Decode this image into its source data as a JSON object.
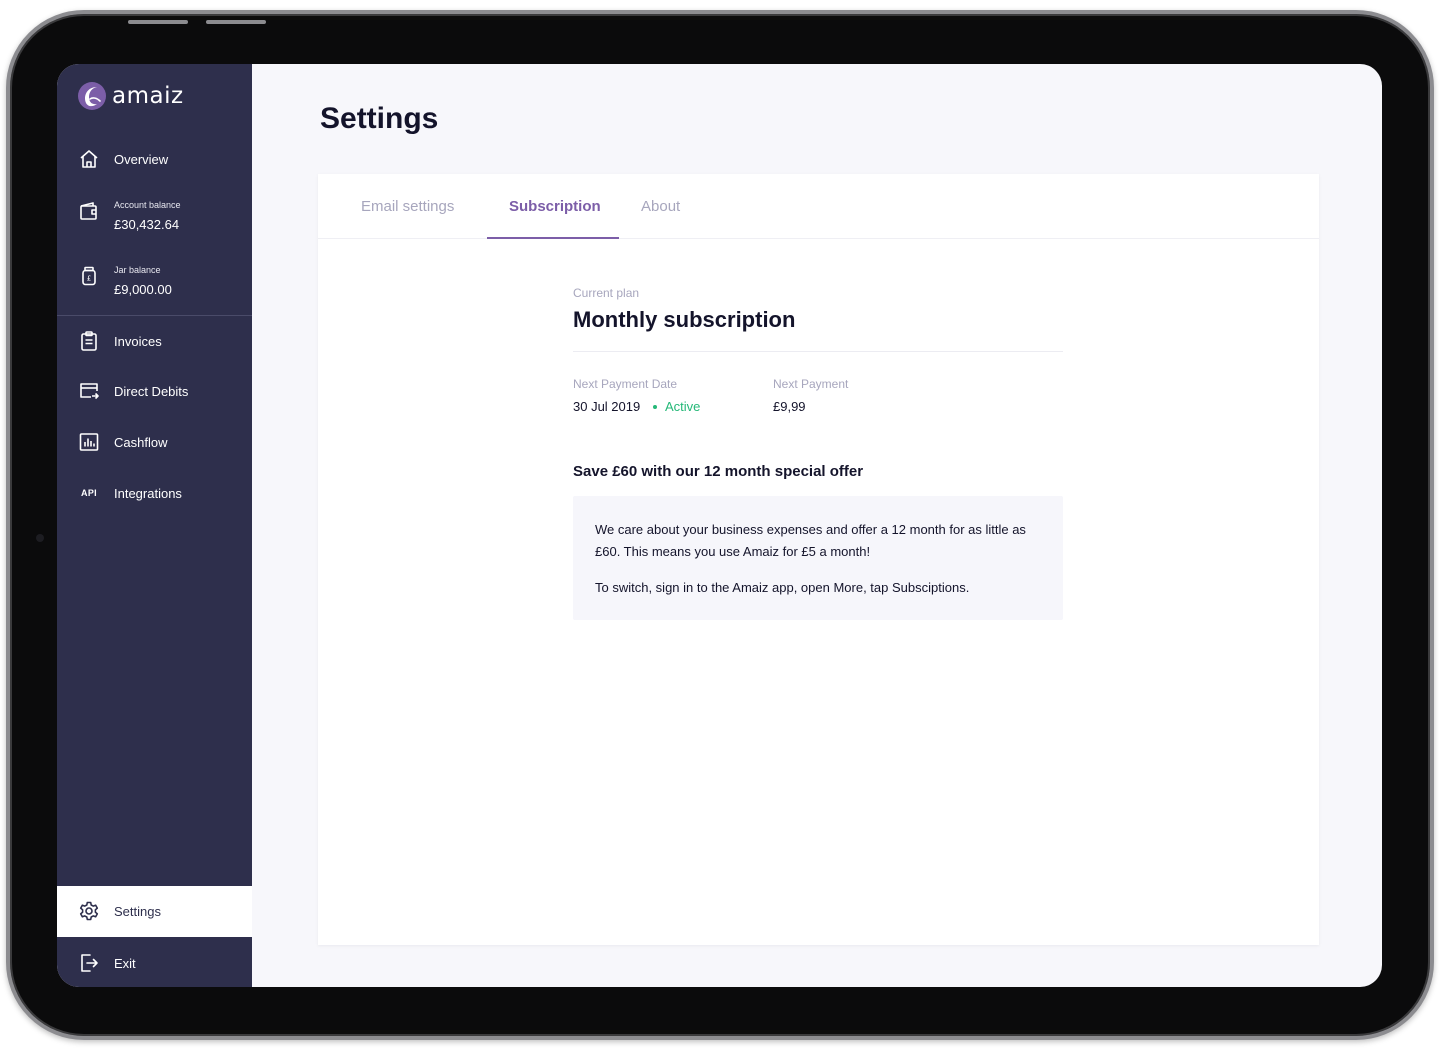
{
  "brand": {
    "name": "amaiz",
    "accent": "#7c5ea8",
    "sidebar_bg": "#2e2f4c",
    "active_green": "#25b878"
  },
  "sidebar": {
    "items": [
      {
        "id": "overview",
        "label": "Overview",
        "icon": "home-icon"
      },
      {
        "id": "account-balance",
        "label": "Account balance",
        "value": "£30,432.64",
        "icon": "wallet-icon"
      },
      {
        "id": "jar-balance",
        "label": "Jar balance",
        "value": "£9,000.00",
        "icon": "jar-icon"
      },
      {
        "id": "invoices",
        "label": "Invoices",
        "icon": "clipboard-icon"
      },
      {
        "id": "direct-debits",
        "label": "Direct Debits",
        "icon": "card-transfer-icon"
      },
      {
        "id": "cashflow",
        "label": "Cashflow",
        "icon": "bar-chart-icon"
      },
      {
        "id": "integrations",
        "label": "Integrations",
        "icon": "api-icon",
        "icon_text": "API"
      },
      {
        "id": "settings",
        "label": "Settings",
        "icon": "gear-icon",
        "active": true
      },
      {
        "id": "exit",
        "label": "Exit",
        "icon": "logout-icon"
      }
    ]
  },
  "page": {
    "title": "Settings",
    "tabs": [
      {
        "label": "Email settings",
        "active": false
      },
      {
        "label": "Subscription",
        "active": true
      },
      {
        "label": "About",
        "active": false
      }
    ]
  },
  "subscription": {
    "current_plan_label": "Current plan",
    "plan_name": "Monthly subscription",
    "next_payment_date_label": "Next Payment Date",
    "next_payment_date": "30 Jul 2019",
    "status": "Active",
    "next_payment_label": "Next Payment",
    "next_payment": "£9,99",
    "offer_title": "Save £60 with our 12 month special offer",
    "offer_paragraph_1": "We care about your business expenses and offer a 12 month for as little as £60. This means you use Amaiz for £5 a month!",
    "offer_paragraph_2": "To switch, sign in to the Amaiz app, open More, tap Subsciptions."
  }
}
